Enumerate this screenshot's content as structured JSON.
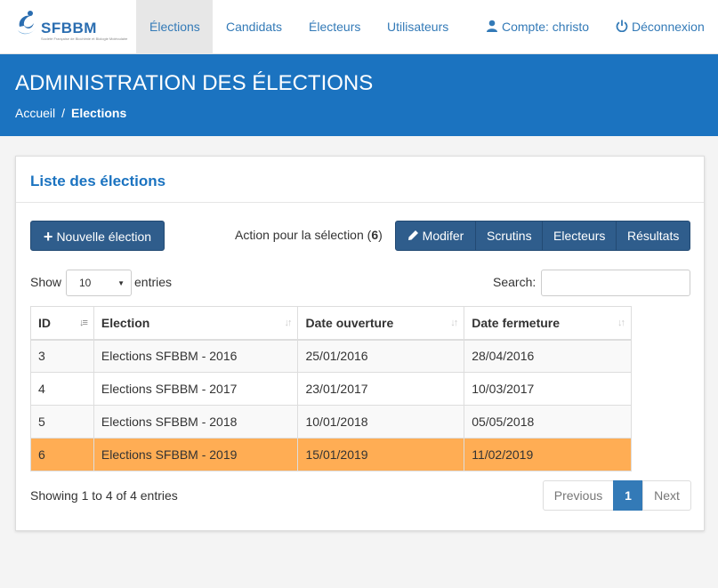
{
  "brand": {
    "logo_text": "SFBBM",
    "logo_sub": "Société Française de Biochimie et Biologie Moléculaire"
  },
  "nav": {
    "items": [
      {
        "label": "Élections",
        "active": true
      },
      {
        "label": "Candidats"
      },
      {
        "label": "Électeurs"
      },
      {
        "label": "Utilisateurs"
      }
    ],
    "account_label": "Compte: christo",
    "account_icon": "user-icon",
    "logout_label": "Déconnexion",
    "logout_icon": "power-icon"
  },
  "header": {
    "title": "ADMINISTRATION DES ÉLECTIONS",
    "breadcrumb": {
      "home": "Accueil",
      "separator": "/",
      "current": "Elections"
    }
  },
  "panel": {
    "title": "Liste des élections",
    "new_button": "Nouvelle élection",
    "action_label_prefix": "Action pour la sélection (",
    "selection_count": "6",
    "action_label_suffix": ")",
    "actions": [
      "Modifer",
      "Scrutins",
      "Electeurs",
      "Résultats"
    ],
    "length": {
      "show": "Show",
      "value": "10",
      "entries": "entries"
    },
    "search_label": "Search:",
    "search_value": "",
    "table": {
      "columns": [
        "ID",
        "Election",
        "Date ouverture",
        "Date fermeture"
      ],
      "rows": [
        {
          "id": "3",
          "election": "Elections SFBBM - 2016",
          "open": "25/01/2016",
          "close": "28/04/2016"
        },
        {
          "id": "4",
          "election": "Elections SFBBM - 2017",
          "open": "23/01/2017",
          "close": "10/03/2017"
        },
        {
          "id": "5",
          "election": "Elections SFBBM - 2018",
          "open": "10/01/2018",
          "close": "05/05/2018"
        },
        {
          "id": "6",
          "election": "Elections SFBBM - 2019",
          "open": "15/01/2019",
          "close": "11/02/2019",
          "selected": true
        }
      ]
    },
    "info": "Showing 1 to 4 of 4 entries",
    "pagination": {
      "previous": "Previous",
      "current": "1",
      "next": "Next"
    }
  },
  "colors": {
    "brand_blue": "#1b73c0",
    "button_blue": "#2f5d8c",
    "selected_row": "#ffad54",
    "pagination_active": "#337ab7"
  }
}
